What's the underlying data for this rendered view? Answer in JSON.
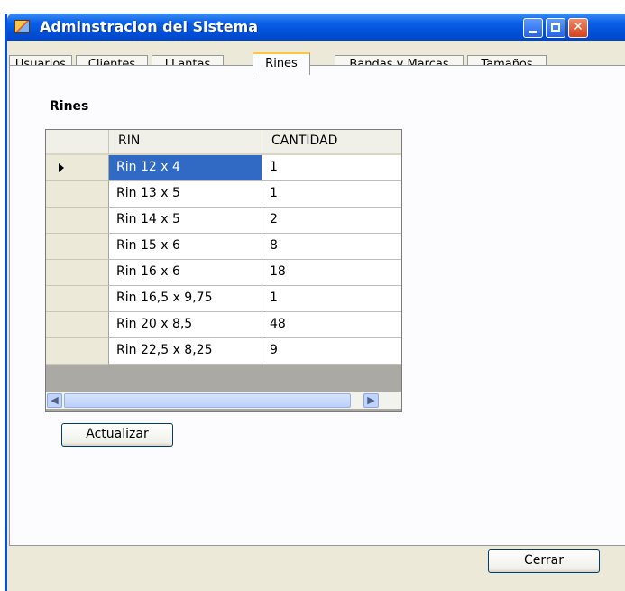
{
  "window": {
    "title": "Adminstracion del Sistema"
  },
  "tabs": [
    {
      "label": "Usuarios"
    },
    {
      "label": "Clientes"
    },
    {
      "label": "LLantas"
    },
    {
      "label": "Rines",
      "active": true
    },
    {
      "label": "Bandas y Marcas"
    },
    {
      "label": "Tamaños"
    }
  ],
  "section_label": "Rines",
  "grid": {
    "columns": [
      "RIN",
      "CANTIDAD"
    ],
    "rows": [
      {
        "rin": "Rin 12 x 4",
        "cantidad": "1",
        "selected": true
      },
      {
        "rin": "Rin 13 x 5",
        "cantidad": "1"
      },
      {
        "rin": "Rin 14 x 5",
        "cantidad": "2"
      },
      {
        "rin": "Rin 15 x 6",
        "cantidad": "8"
      },
      {
        "rin": "Rin 16 x 6",
        "cantidad": "18"
      },
      {
        "rin": "Rin 16,5 x 9,75",
        "cantidad": "1"
      },
      {
        "rin": "Rin 20 x 8,5",
        "cantidad": "48"
      },
      {
        "rin": "Rin 22,5 x 8,25",
        "cantidad": "9"
      }
    ]
  },
  "buttons": {
    "refresh_label": "Actualizar",
    "close_label": "Cerrar"
  },
  "colors": {
    "titlebar": "#0050d8",
    "selection": "#316ac5",
    "window_bg": "#ece9d8",
    "active_tab_accent": "#ffc83c"
  }
}
